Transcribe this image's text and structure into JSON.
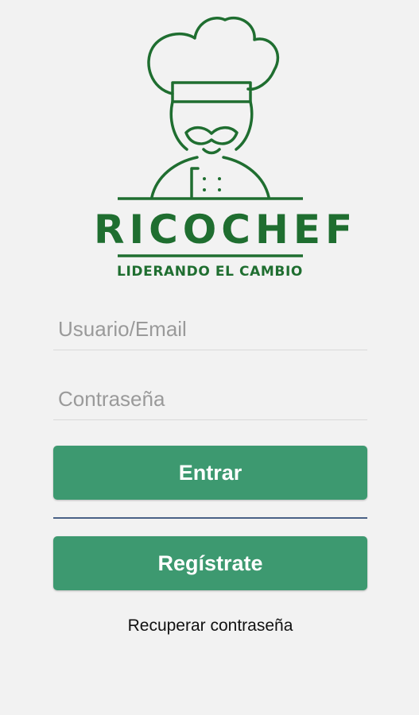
{
  "brand": {
    "name": "RICOCHEF",
    "tagline": "LIDERANDO EL CAMBIO",
    "color": "#1f6e30"
  },
  "login": {
    "username_placeholder": "Usuario/Email",
    "username_value": "",
    "password_placeholder": "Contraseña",
    "password_value": "",
    "enter_label": "Entrar",
    "register_label": "Regístrate",
    "recover_label": "Recuperar contraseña",
    "button_color": "#3d9970"
  }
}
